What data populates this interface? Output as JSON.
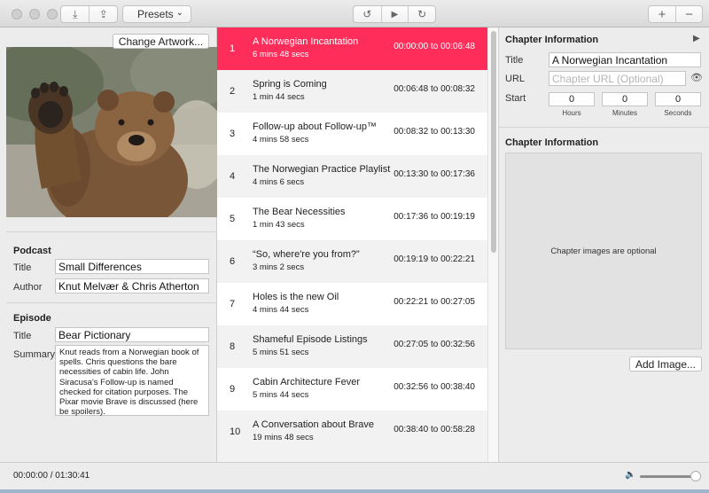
{
  "toolbar": {
    "presets_label": "Presets",
    "presets_chevron": "⌄",
    "download_icon": "⤓",
    "share_icon": "⇪",
    "rewind_icon": "↺",
    "play_icon": "▶",
    "forward_icon": "↻",
    "add_icon": "+",
    "remove_icon": "−"
  },
  "artwork": {
    "change_button": "Change Artwork..."
  },
  "podcast": {
    "heading": "Podcast",
    "title_label": "Title",
    "title_value": "Small Differences",
    "author_label": "Author",
    "author_value": "Knut Melvær & Chris Atherton"
  },
  "episode": {
    "heading": "Episode",
    "title_label": "Title",
    "title_value": "Bear Pictionary",
    "summary_label": "Summary",
    "summary_value": "Knut reads from a Norwegian book of spells. Chris questions the bare necessities of cabin life. John Siracusa's Follow-up is named checked for citation purposes. The Pixar movie Brave is discussed (here be spoilers)."
  },
  "chapters": [
    {
      "num": "1",
      "title": "A Norwegian Incantation",
      "duration": "6 mins 48 secs",
      "time": "00:00:00 to 00:06:48",
      "selected": true
    },
    {
      "num": "2",
      "title": "Spring is Coming",
      "duration": "1 min 44 secs",
      "time": "00:06:48 to 00:08:32"
    },
    {
      "num": "3",
      "title": "Follow-up about Follow-up™",
      "duration": "4 mins 58 secs",
      "time": "00:08:32 to 00:13:30"
    },
    {
      "num": "4",
      "title": "The Norwegian Practice Playlist",
      "duration": "4 mins 6 secs",
      "time": "00:13:30 to 00:17:36"
    },
    {
      "num": "5",
      "title": "The Bear Necessities",
      "duration": "1 min 43 secs",
      "time": "00:17:36 to 00:19:19"
    },
    {
      "num": "6",
      "title": "“So, where're you from?”",
      "duration": "3 mins 2 secs",
      "time": "00:19:19 to 00:22:21"
    },
    {
      "num": "7",
      "title": "Holes is the new Oil",
      "duration": "4 mins 44 secs",
      "time": "00:22:21 to 00:27:05"
    },
    {
      "num": "8",
      "title": "Shameful Episode Listings",
      "duration": "5 mins 51 secs",
      "time": "00:27:05 to 00:32:56"
    },
    {
      "num": "9",
      "title": "Cabin Architecture Fever",
      "duration": "5 mins 44 secs",
      "time": "00:32:56 to 00:38:40"
    },
    {
      "num": "10",
      "title": "A Conversation about Brave",
      "duration": "19 mins 48 secs",
      "time": "00:38:40 to 00:58:28"
    }
  ],
  "chapter_info": {
    "heading": "Chapter Information",
    "play_icon": "▶",
    "title_label": "Title",
    "title_value": "A Norwegian Incantation",
    "url_label": "URL",
    "url_placeholder": "Chapter URL (Optional)",
    "eye_icon": "👁",
    "start_label": "Start",
    "hours_value": "0",
    "minutes_value": "0",
    "seconds_value": "0",
    "hours_label": "Hours",
    "minutes_label": "Minutes",
    "seconds_label": "Seconds"
  },
  "chapter_image": {
    "heading": "Chapter Information",
    "placeholder": "Chapter images are optional",
    "add_button": "Add Image..."
  },
  "status": {
    "timecode": "00:00:00 / 01:30:41",
    "volume_icon": "🔈",
    "volume_level": 0.95
  },
  "colors": {
    "selection": "#ff2d5a"
  }
}
